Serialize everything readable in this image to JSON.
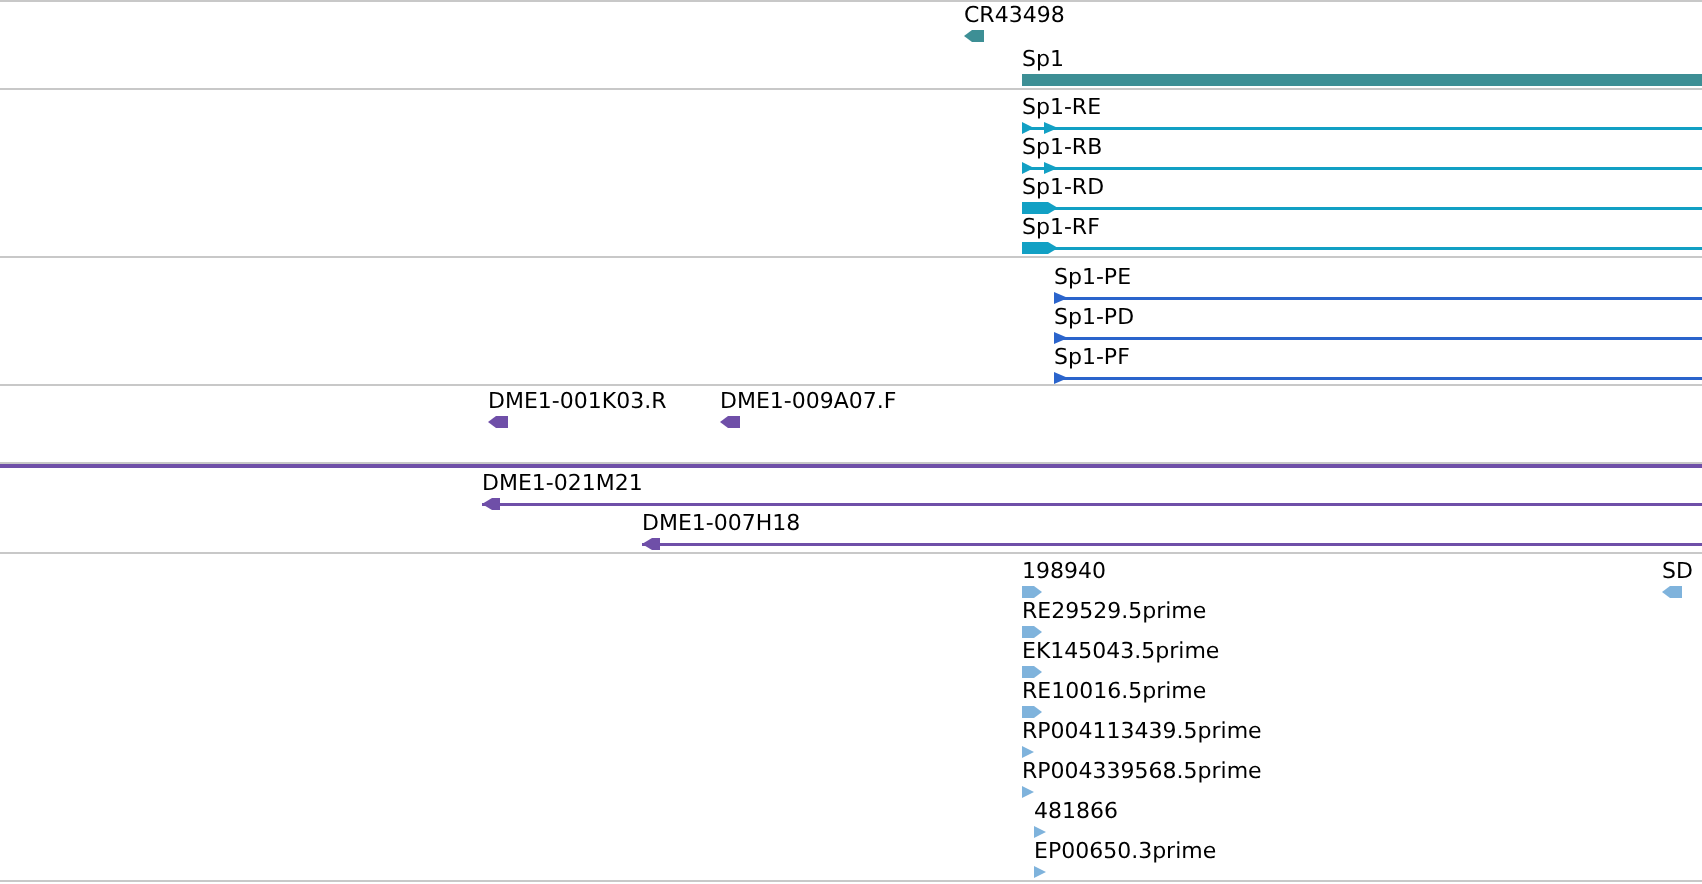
{
  "tracks": [
    {
      "color": "#3d8f95",
      "features": [
        {
          "label": "CR43498",
          "kind": "marker",
          "reverse": true
        },
        {
          "label": "Sp1",
          "kind": "gene"
        }
      ]
    },
    {
      "color": "#12a0c4",
      "features": [
        {
          "label": "Sp1-RE",
          "kind": "transcript-split",
          "reverse": false
        },
        {
          "label": "Sp1-RB",
          "kind": "transcript-split",
          "reverse": false
        },
        {
          "label": "Sp1-RD",
          "kind": "transcript-thick",
          "reverse": false
        },
        {
          "label": "Sp1-RF",
          "kind": "transcript-thick",
          "reverse": false
        }
      ]
    },
    {
      "color": "#2a64cc",
      "features": [
        {
          "label": "Sp1-PE",
          "kind": "transcript",
          "reverse": false
        },
        {
          "label": "Sp1-PD",
          "kind": "transcript",
          "reverse": false
        },
        {
          "label": "Sp1-PF",
          "kind": "transcript",
          "reverse": false
        }
      ]
    },
    {
      "color": "#6f4fa8",
      "features": [
        {
          "label": "DME1-001K03.R",
          "kind": "marker",
          "reverse": true
        },
        {
          "label": "DME1-009A07.F",
          "kind": "marker",
          "reverse": true
        }
      ]
    },
    {
      "color": "#6f4fa8",
      "features": [
        {
          "label": "DME1-021M21",
          "kind": "clone",
          "reverse": true
        },
        {
          "label": "DME1-007H18",
          "kind": "clone",
          "reverse": true
        }
      ]
    },
    {
      "color": "#7fb3dc",
      "features": [
        {
          "label": "198940",
          "kind": "marker",
          "reverse": false
        },
        {
          "label": "RE29529.5prime",
          "kind": "marker",
          "reverse": false
        },
        {
          "label": "EK145043.5prime",
          "kind": "marker",
          "reverse": false
        },
        {
          "label": "RE10016.5prime",
          "kind": "marker",
          "reverse": false
        },
        {
          "label": "RP004113439.5prime",
          "kind": "small-marker",
          "reverse": false
        },
        {
          "label": "RP004339568.5prime",
          "kind": "small-marker",
          "reverse": false
        },
        {
          "label": "481866",
          "kind": "small-marker",
          "reverse": false
        },
        {
          "label": "EP00650.3prime",
          "kind": "small-marker",
          "reverse": false
        },
        {
          "label": "SD",
          "kind": "marker",
          "reverse": true
        }
      ]
    }
  ]
}
